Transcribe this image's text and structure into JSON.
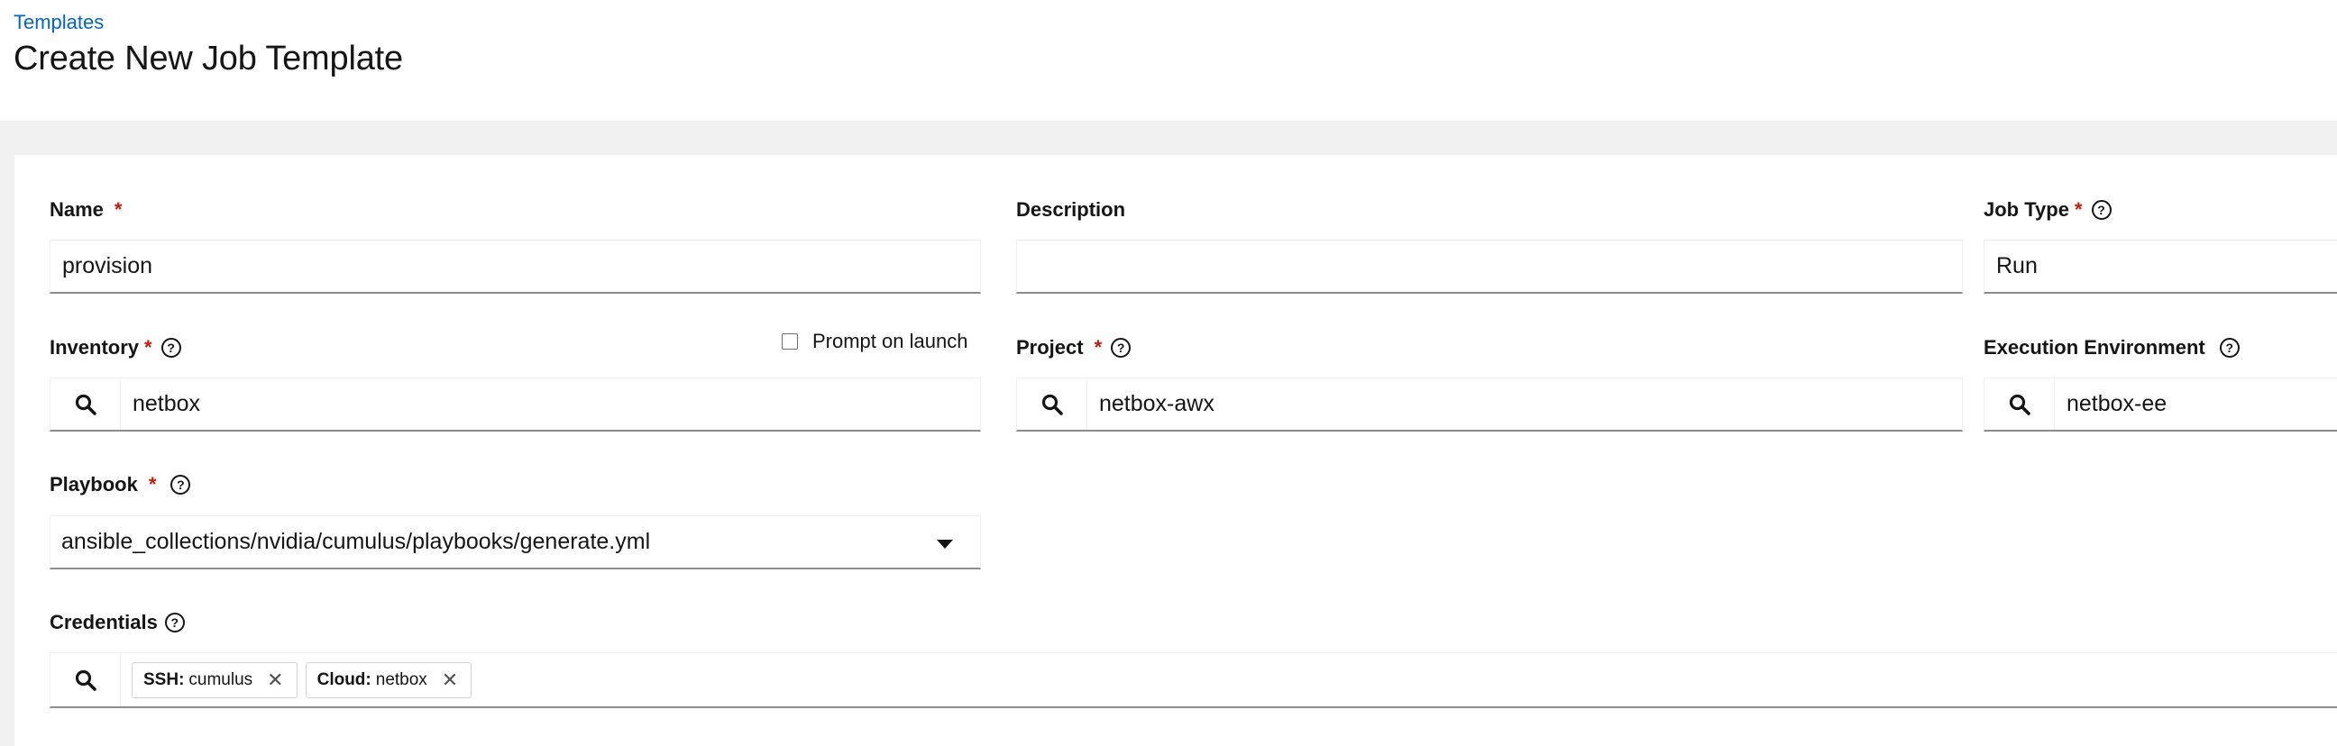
{
  "header": {
    "breadcrumb": "Templates",
    "title": "Create New Job Template"
  },
  "form": {
    "name": {
      "label": "Name",
      "required": "*",
      "value": "provision"
    },
    "description": {
      "label": "Description",
      "value": ""
    },
    "job_type": {
      "label": "Job Type",
      "required": "*",
      "value": "Run"
    },
    "inventory": {
      "label": "Inventory",
      "required": "*",
      "value": "netbox",
      "prompt_label": "Prompt on launch",
      "prompt_checked": false
    },
    "project": {
      "label": "Project",
      "required": "*",
      "value": "netbox-awx"
    },
    "execution_environment": {
      "label": "Execution Environment",
      "value": "netbox-ee"
    },
    "playbook": {
      "label": "Playbook",
      "required": "*",
      "value": "ansible_collections/nvidia/cumulus/playbooks/generate.yml"
    },
    "credentials": {
      "label": "Credentials",
      "chips": [
        {
          "kind": "SSH:",
          "name": "cumulus"
        },
        {
          "kind": "Cloud:",
          "name": "netbox"
        }
      ]
    },
    "help_glyph": "?",
    "close_glyph": "✕"
  },
  "colors": {
    "link": "#0066cc",
    "required": "#c9190b",
    "page_bg": "#f0f0f0",
    "input_border": "#8a8d90"
  },
  "icons": [
    "search-icon",
    "help-icon",
    "caret-down-icon",
    "close-icon",
    "checkbox-icon"
  ]
}
